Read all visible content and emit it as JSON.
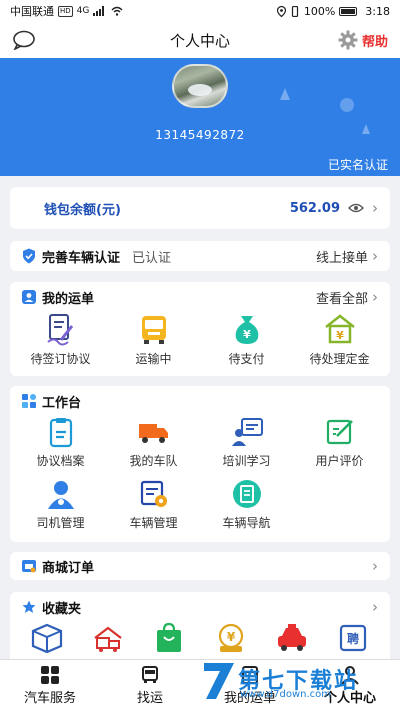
{
  "status_bar": {
    "carrier": "中国联通",
    "network_badge": "HD",
    "network": "4G",
    "battery": "100%",
    "time": "3:18"
  },
  "nav": {
    "title": "个人中心",
    "help_label": "帮助"
  },
  "profile": {
    "phone": "13145492872",
    "verified_label": "已实名认证"
  },
  "wallet": {
    "label": "钱包余额(元)",
    "amount": "562.09"
  },
  "vehicle": {
    "title": "完善车辆认证",
    "status": "已认证",
    "action": "线上接单"
  },
  "orders": {
    "title": "我的运单",
    "view_all": "查看全部",
    "items": [
      {
        "label": "待签订协议",
        "icon": "sign-contract-icon"
      },
      {
        "label": "运输中",
        "icon": "bus-icon"
      },
      {
        "label": "待支付",
        "icon": "money-bag-icon"
      },
      {
        "label": "待处理定金",
        "icon": "house-deposit-icon"
      }
    ]
  },
  "workbench": {
    "title": "工作台",
    "items": [
      {
        "label": "协议档案",
        "icon": "clipboard-icon"
      },
      {
        "label": "我的车队",
        "icon": "truck-icon"
      },
      {
        "label": "培训学习",
        "icon": "training-icon"
      },
      {
        "label": "用户评价",
        "icon": "review-icon"
      },
      {
        "label": "司机管理",
        "icon": "driver-icon"
      },
      {
        "label": "车辆管理",
        "icon": "vehicle-settings-icon"
      },
      {
        "label": "车辆导航",
        "icon": "navigation-icon"
      }
    ]
  },
  "mall": {
    "title": "商城订单"
  },
  "favorites": {
    "title": "收藏夹",
    "icons": [
      "box-icon",
      "truck-house-icon",
      "shopping-bag-icon",
      "money-car-icon",
      "taxi-icon",
      "recruit-icon"
    ]
  },
  "tabbar": {
    "items": [
      {
        "label": "汽车服务",
        "icon": "grid-icon"
      },
      {
        "label": "找运",
        "icon": "truck-front-icon"
      },
      {
        "label": "我的运单",
        "icon": "waybill-icon"
      },
      {
        "label": "个人中心",
        "icon": "person-icon"
      }
    ]
  },
  "watermark": {
    "text": "第七下载站",
    "url": "www.d7down.com"
  },
  "colors": {
    "primary": "#2f7fe6",
    "help_red": "#e8312f",
    "wallet_blue": "#1f4fb5"
  }
}
